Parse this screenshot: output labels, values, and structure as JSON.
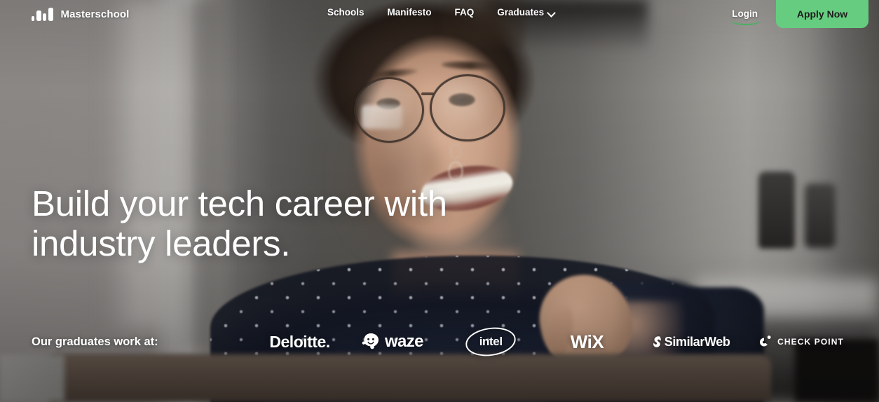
{
  "brand": {
    "name": "Masterschool",
    "logo_icon": "masterschool-bars-icon"
  },
  "nav": {
    "links": [
      {
        "label": "Schools",
        "icon": null
      },
      {
        "label": "Manifesto",
        "icon": null
      },
      {
        "label": "FAQ",
        "icon": null
      },
      {
        "label": "Graduates",
        "icon": "chevron-down-icon"
      }
    ],
    "login_label": "Login",
    "apply_label": "Apply Now"
  },
  "hero": {
    "headline_line1": "Build your tech career with",
    "headline_line2": "industry leaders."
  },
  "partners": {
    "label": "Our graduates work at:",
    "logos": [
      {
        "name": "Deloitte",
        "text": "Deloitte",
        "suffix": ".",
        "icon": null
      },
      {
        "name": "Waze",
        "text": "waze",
        "icon": "waze-smiley-icon"
      },
      {
        "name": "Intel",
        "text": "intel",
        "icon": "intel-ellipse-icon"
      },
      {
        "name": "Wix",
        "text": "WiX",
        "icon": null
      },
      {
        "name": "SimilarWeb",
        "text": "SimilarWeb",
        "icon": "similarweb-swirl-icon"
      },
      {
        "name": "Check Point",
        "text": "CHECK POINT",
        "icon": "checkpoint-circle-icon"
      }
    ]
  },
  "colors": {
    "accent_green": "#66cd80",
    "login_underline": "#4caf63",
    "text_light": "#ffffff",
    "button_text": "#1b1b1b"
  }
}
